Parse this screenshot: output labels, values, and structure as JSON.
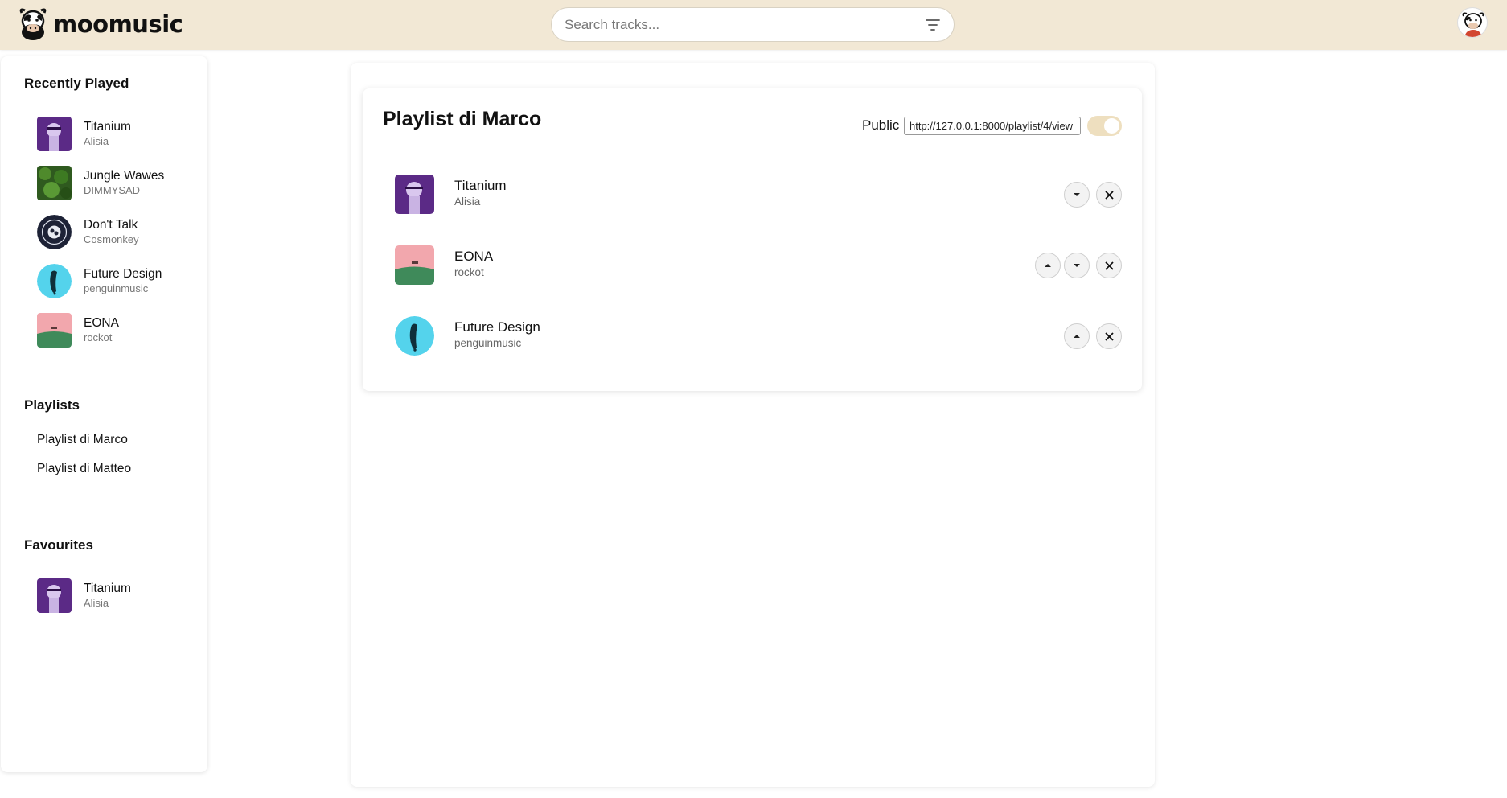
{
  "header": {
    "logo_text": "moomusic",
    "search_placeholder": "Search tracks..."
  },
  "sidebar": {
    "recent_heading": "Recently Played",
    "recent": [
      {
        "title": "Titanium",
        "artist": "Alisia"
      },
      {
        "title": "Jungle Wawes",
        "artist": "DIMMYSAD"
      },
      {
        "title": "Don't Talk",
        "artist": "Cosmonkey"
      },
      {
        "title": "Future Design",
        "artist": "penguinmusic"
      },
      {
        "title": "EONA",
        "artist": "rockot"
      }
    ],
    "playlists_heading": "Playlists",
    "playlists": [
      "Playlist di Marco",
      "Playlist di Matteo"
    ],
    "favourites_heading": "Favourites",
    "favourites": [
      {
        "title": "Titanium",
        "artist": "Alisia"
      }
    ]
  },
  "playlist": {
    "title": "Playlist di Marco",
    "public_label": "Public",
    "share_url": "http://127.0.0.1:8000/playlist/4/view",
    "is_public": true,
    "tracks": [
      {
        "title": "Titanium",
        "artist": "Alisia"
      },
      {
        "title": "EONA",
        "artist": "rockot"
      },
      {
        "title": "Future Design",
        "artist": "penguinmusic"
      }
    ]
  },
  "colors": {
    "header_bg": "#f2e8d5",
    "toggle_on": "#eedfbf"
  },
  "icons": [
    "cow-logo-icon",
    "filter-icon",
    "user-avatar-icon",
    "chevron-up-icon",
    "chevron-down-icon",
    "close-icon"
  ]
}
